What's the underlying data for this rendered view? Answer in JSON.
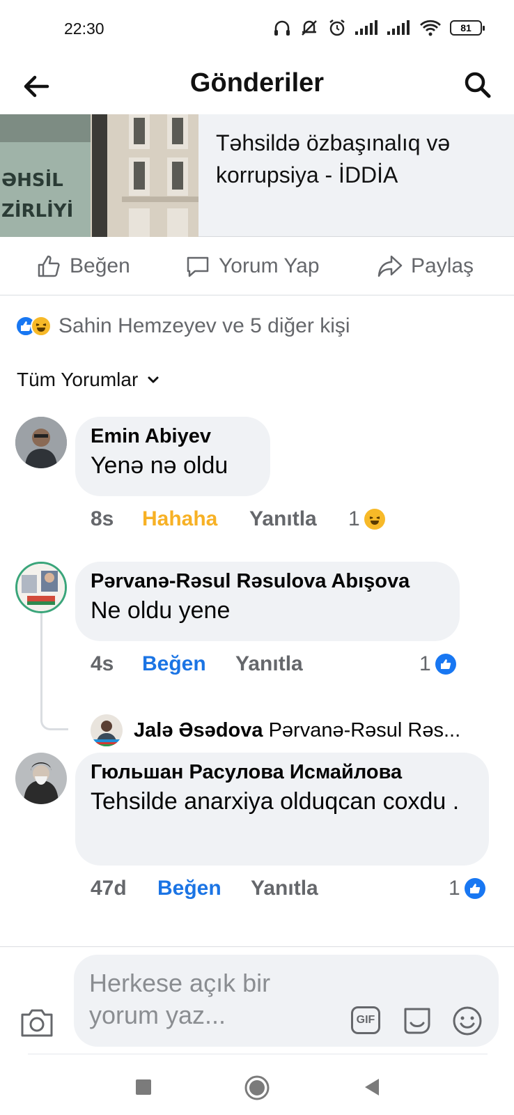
{
  "status_bar": {
    "time": "22:30",
    "battery": "81"
  },
  "header": {
    "title": "Gönderiler"
  },
  "preview": {
    "headline": "Təhsildə özbaşınalıq və korrupsiya - İDDİA",
    "thumb_text": [
      "ƏHSİL",
      "ZİRLİYİ"
    ]
  },
  "actions": {
    "like": "Beğen",
    "comment": "Yorum Yap",
    "share": "Paylaş"
  },
  "reactions": {
    "summary": "Sahin Hemzeyev ve 5 diğer kişi"
  },
  "filter": {
    "label": "Tüm Yorumlar"
  },
  "comments": [
    {
      "author": "Emin Abiyev",
      "text": "Yenə nə oldu",
      "time": "8s",
      "reaction_link": "Hahaha",
      "reply": "Yanıtla",
      "count": "1",
      "count_icon": "haha-icon"
    },
    {
      "author": "Pərvanə-Rəsul Rəsulova Abışova",
      "text": "Ne oldu yene",
      "time": "4s",
      "reaction_link": "Beğen",
      "reply": "Yanıtla",
      "count": "1",
      "count_icon": "like-icon"
    },
    {
      "author": "Гюльшан Расулова Исмайлова",
      "text": "Tehsilde anarxiya olduqcan coxdu .",
      "time": "47d",
      "reaction_link": "Beğen",
      "reply": "Yanıtla",
      "count": "1",
      "count_icon": "like-icon"
    }
  ],
  "reply_preview": {
    "author": "Jalə Əsədova",
    "snippet": "Pərvanə-Rəsul Rəs..."
  },
  "composer": {
    "placeholder": "Herkese açık bir yorum yaz...",
    "gif": "GIF"
  },
  "colors": {
    "accent_blue": "#1b74e4",
    "haha_yellow": "#f7b125",
    "bubble_bg": "#f0f2f5",
    "muted_text": "#65676b"
  }
}
